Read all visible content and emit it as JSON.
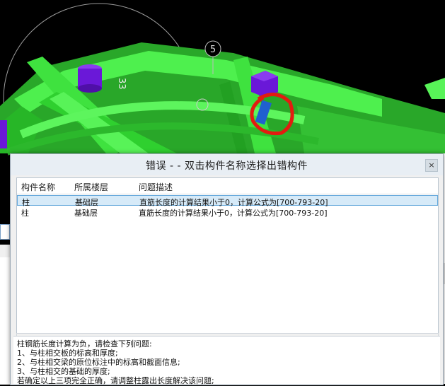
{
  "scene": {
    "axis_label_5": "5",
    "axis_label_33": "33"
  },
  "dialog": {
    "title": "错误 - - 双击构件名称选择出错构件",
    "close_icon": "close-icon",
    "columns": [
      "构件名称",
      "所属楼层",
      "问题描述"
    ],
    "rows": [
      {
        "name": "柱",
        "floor": "基础层",
        "desc": "直筋长度的计算结果小于0，计算公式为[700-793-20]",
        "selected": true
      },
      {
        "name": "柱",
        "floor": "基础层",
        "desc": "直筋长度的计算结果小于0，计算公式为[700-793-20]",
        "selected": false
      }
    ],
    "scroll_left": "‹",
    "scroll_right": "›",
    "hint_lines": [
      "柱钢筋长度计算为负，请检查下列问题:",
      "1、与柱相交板的标高和厚度;",
      "2、与柱相交梁的原位标注中的标高和截面信息;",
      "3、与柱相交的基础的厚度;",
      "若确定以上三项完全正确，请调整柱露出长度解决该问题;"
    ]
  },
  "colors": {
    "beam_green": "#3fe23f",
    "column_purple": "#6a18d8",
    "marker_red": "#e21c10",
    "selection_bg": "#d6eaf8"
  }
}
